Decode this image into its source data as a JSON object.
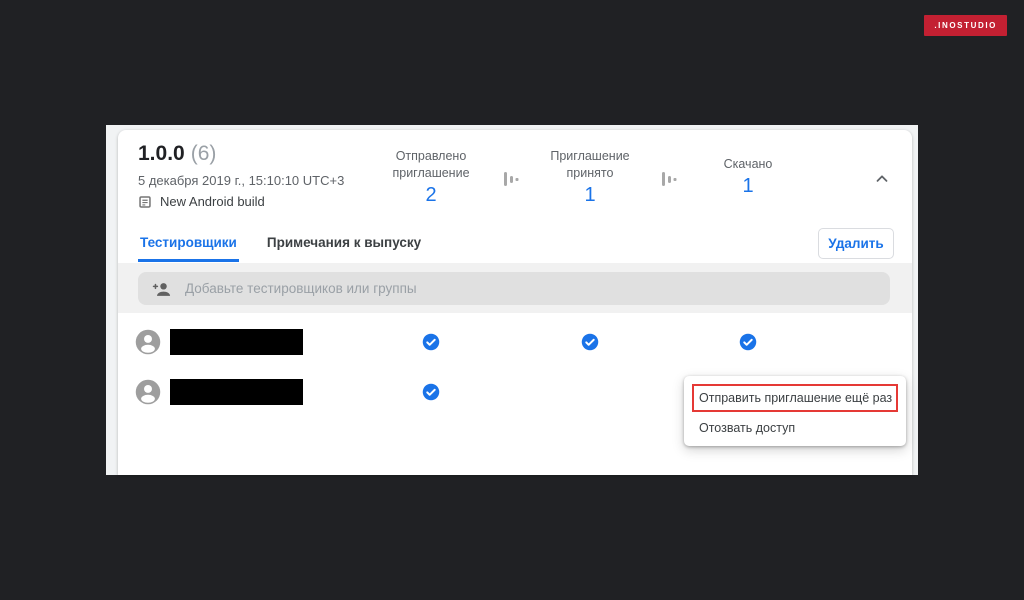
{
  "brand": {
    "label": ".INOSTUDIO",
    "color": "#c32032"
  },
  "release": {
    "version": "1.0.0",
    "build_number": "(6)",
    "date": "5 декабря 2019 г., 15:10:10 UTC+3",
    "build_note": "New Android build",
    "stats": [
      {
        "label": "Отправлено приглашение",
        "lines": [
          "Отправлено",
          "приглашение"
        ],
        "value": "2"
      },
      {
        "label": "Приглашение принято",
        "lines": [
          "Приглашение",
          "принято"
        ],
        "value": "1"
      },
      {
        "label": "Скачано",
        "lines": [
          "Скачано"
        ],
        "value": "1"
      }
    ],
    "tabs": [
      {
        "label": "Тестировщики",
        "active": true
      },
      {
        "label": "Примечания к выпуску",
        "active": false
      }
    ],
    "delete_button_label": "Удалить",
    "add_testers_placeholder": "Добавьте тестировщиков или группы",
    "testers": [
      {
        "name_redacted": true,
        "invite_sent": true,
        "invite_accepted": true,
        "downloaded": true
      },
      {
        "name_redacted": true,
        "invite_sent": true,
        "invite_accepted": false,
        "downloaded": false
      }
    ],
    "context_menu": {
      "items": [
        {
          "label": "Отправить приглашение ещё раз",
          "highlighted": true
        },
        {
          "label": "Отозвать доступ",
          "highlighted": false
        }
      ]
    },
    "colors": {
      "accent_blue": "#1a73e8",
      "highlight_red": "#e53935",
      "page_dark": "#202124"
    }
  }
}
